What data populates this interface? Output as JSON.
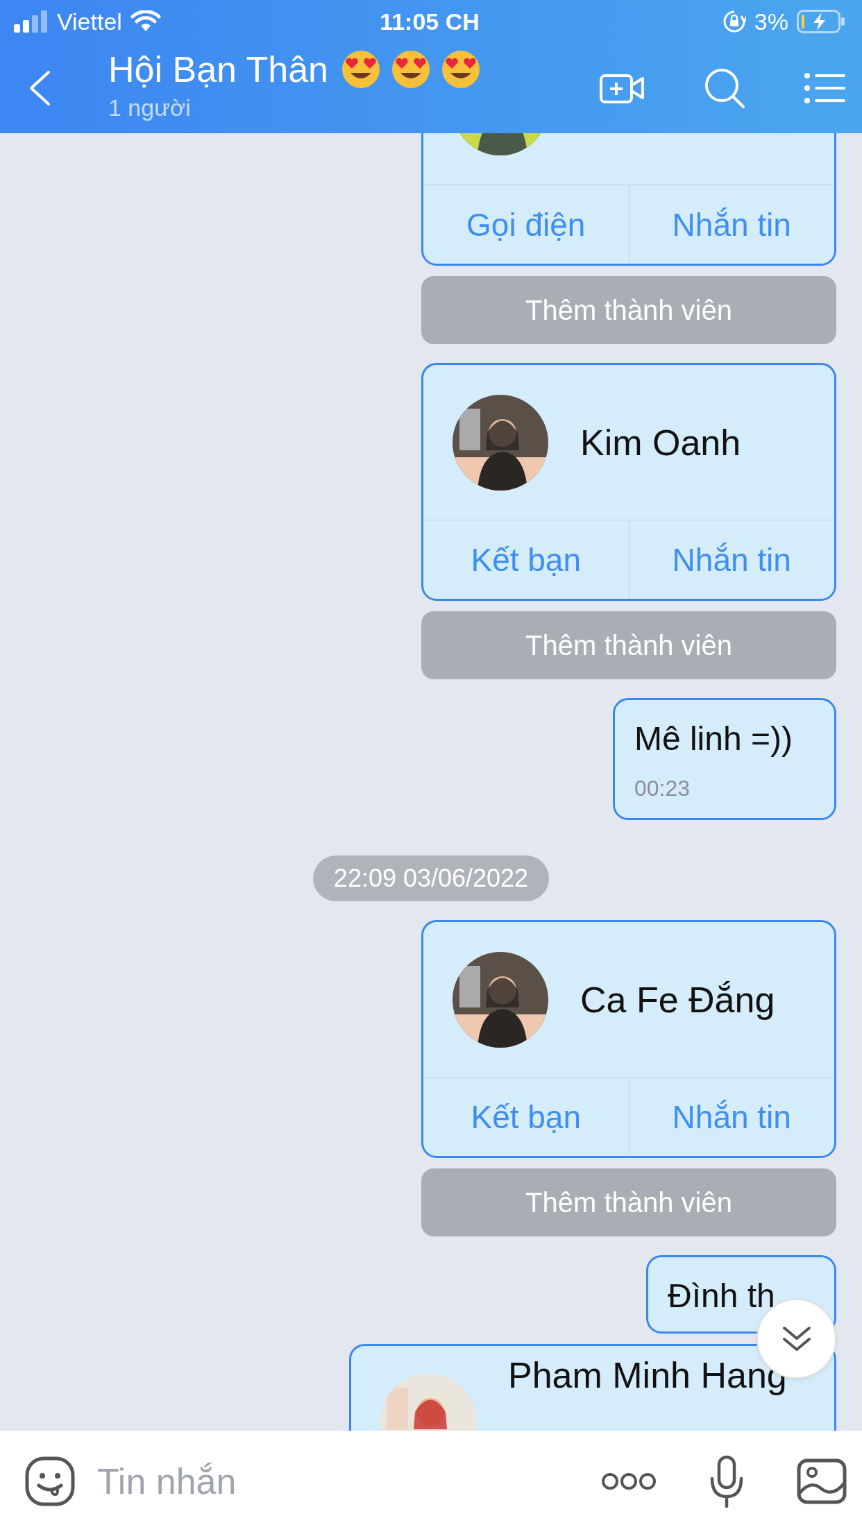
{
  "status_bar": {
    "carrier": "Viettel",
    "time": "11:05 CH",
    "battery": "3%"
  },
  "header": {
    "title": "Hội Bạn Thân",
    "emojis": [
      {
        "kind": "heart_eyes"
      },
      {
        "kind": "heart_eyes"
      },
      {
        "kind": "heart_eyes"
      }
    ],
    "subtitle": "1 người"
  },
  "messages": [
    {
      "kind": "contact",
      "avatar": {
        "kind": "picture"
      },
      "buttons": [
        "Gọi điện",
        "Nhắn tin"
      ]
    },
    {
      "kind": "action",
      "text": "Thêm thành viên"
    },
    {
      "kind": "contact",
      "name": "Kim Oanh",
      "avatar": {
        "kind": "picture"
      },
      "buttons": [
        "Kết bạn",
        "Nhắn tin"
      ]
    },
    {
      "kind": "action",
      "text": "Thêm thành viên"
    },
    {
      "kind": "text",
      "text": "Mê linh =))",
      "time": "00:23"
    },
    {
      "kind": "date",
      "text": "22:09 03/06/2022"
    },
    {
      "kind": "contact",
      "name": "Ca Fe Đắng",
      "avatar": {
        "kind": "picture"
      },
      "buttons": [
        "Kết bạn",
        "Nhắn tin"
      ]
    },
    {
      "kind": "action",
      "text": "Thêm thành viên"
    },
    {
      "kind": "text",
      "text": "Đình th"
    },
    {
      "kind": "contact",
      "name": "Pham Minh Hang",
      "avatar": {
        "kind": "picture"
      }
    }
  ],
  "input": {
    "placeholder": "Tin nhắn"
  }
}
